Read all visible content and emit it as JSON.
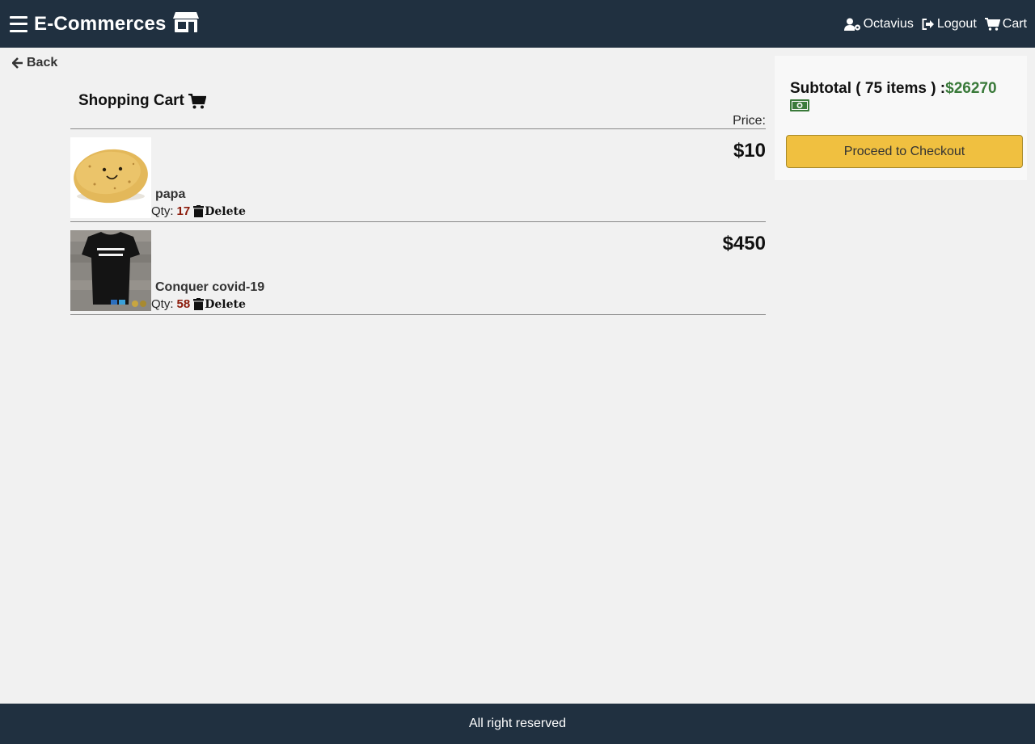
{
  "header": {
    "brand": "E-Commerces",
    "user_name": "Octavius",
    "logout_label": "Logout",
    "cart_label": "Cart"
  },
  "back_label": "Back",
  "cart": {
    "title": "Shopping Cart",
    "price_header": "Price:",
    "qty_label": "Qty:",
    "delete_label": "Delete",
    "items": [
      {
        "name": "papa",
        "price": "$10",
        "qty": "17"
      },
      {
        "name": "Conquer covid-19",
        "price": "$450",
        "qty": "58"
      }
    ]
  },
  "summary": {
    "subtotal_label": "Subtotal ( 75 items ) :",
    "subtotal_amount": "$26270",
    "checkout_label": "Proceed to Checkout"
  },
  "footer": {
    "text": "All right reserved"
  },
  "colors": {
    "nav_bg": "#203040",
    "page_bg": "#f1f1f1",
    "checkout_btn": "#f0c040",
    "amount_green": "#3a7a3a",
    "qty_red": "#8b1a0a"
  }
}
